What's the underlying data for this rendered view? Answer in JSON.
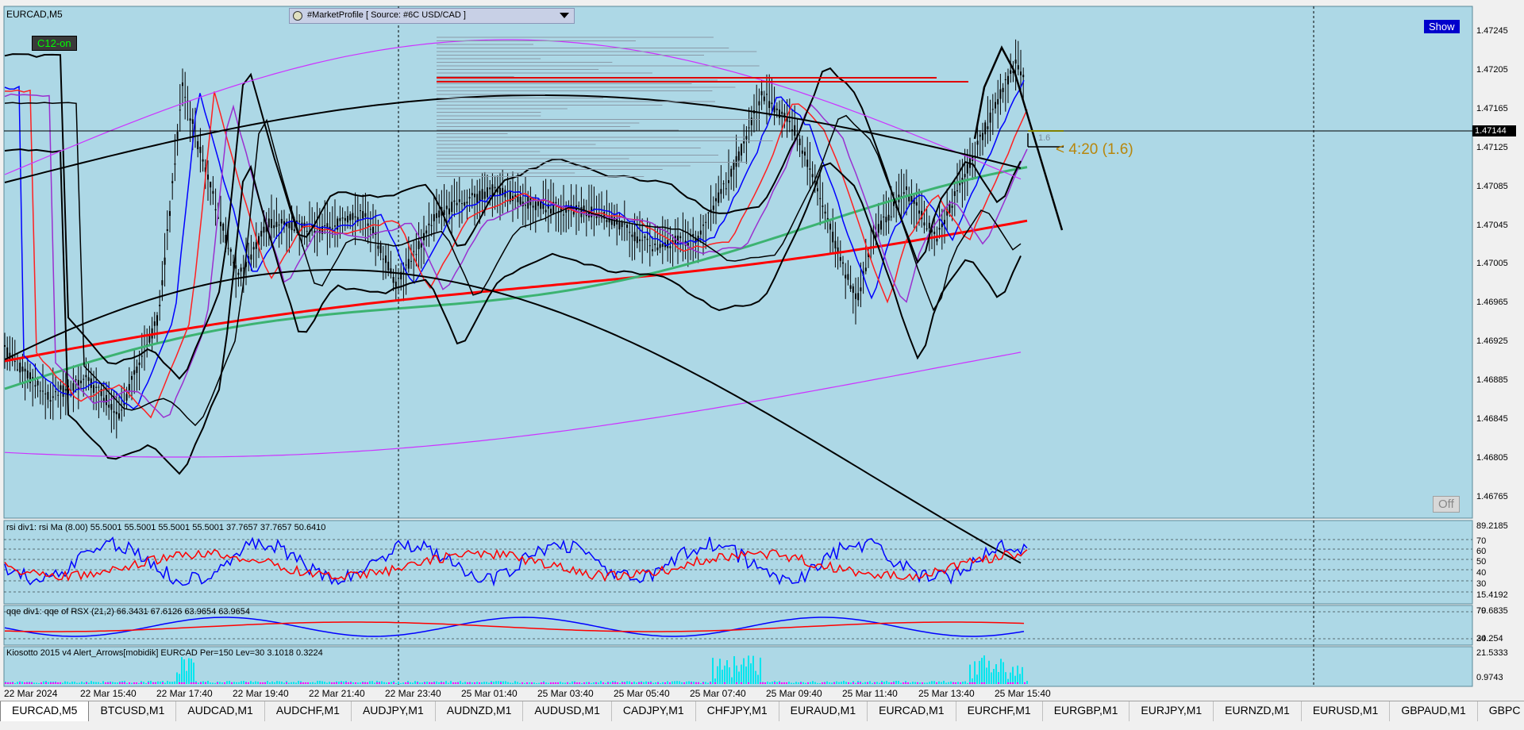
{
  "window": {
    "symbol_title": "EURCAD,M5",
    "market_profile_label": "#MarketProfile [ Source: #6C USD/CAD ]",
    "c12_label": "C12-on",
    "show_label": "Show",
    "off_label": "Off",
    "current_price": "1.47144",
    "countdown_label": "< 4:20 (1.6)",
    "spread_label": "1.6"
  },
  "price_axis": {
    "ticks": [
      "1.47245",
      "1.47205",
      "1.47165",
      "1.47125",
      "1.47085",
      "1.47045",
      "1.47005",
      "1.46965",
      "1.46925",
      "1.46885",
      "1.46845",
      "1.46805",
      "1.46765"
    ]
  },
  "time_axis": {
    "ticks": [
      "22 Mar 2024",
      "22 Mar 15:40",
      "22 Mar 17:40",
      "22 Mar 19:40",
      "22 Mar 21:40",
      "22 Mar 23:40",
      "25 Mar 01:40",
      "25 Mar 03:40",
      "25 Mar 05:40",
      "25 Mar 07:40",
      "25 Mar 09:40",
      "25 Mar 11:40",
      "25 Mar 13:40",
      "25 Mar 15:40"
    ]
  },
  "rsi_panel": {
    "title": "rsi div1: rsi Ma (8.00) 55.5001 55.5001 55.5001 55.5001 37.7657 37.7657 50.6410",
    "levels": [
      "89.2185",
      "70",
      "60",
      "50",
      "40",
      "30",
      "15.4192"
    ]
  },
  "rsx_panel": {
    "title": "qqe div1: qqe of RSX (21,2) 66.3431 67.6126 63.9654 63.9654",
    "levels": [
      "79.6835",
      "70",
      "24.254",
      "30"
    ]
  },
  "kiosotto_panel": {
    "title": "Kiosotto 2015 v4 Alert_Arrows[mobidik] EURCAD Per=150 Lev=30 3.1018 0.3224",
    "levels": [
      "21.5333",
      "0.9743"
    ]
  },
  "tabs": [
    "EURCAD,M5",
    "BTCUSD,M1",
    "AUDCAD,M1",
    "AUDCHF,M1",
    "AUDJPY,M1",
    "AUDNZD,M1",
    "AUDUSD,M1",
    "CADJPY,M1",
    "CHFJPY,M1",
    "EURAUD,M1",
    "EURCAD,M1",
    "EURCHF,M1",
    "EURGBP,M1",
    "EURJPY,M1",
    "EURNZD,M1",
    "EURUSD,M1",
    "GBPAUD,M1",
    "GBPC"
  ],
  "colors": {
    "chart_bg": "#add8e6",
    "up_candle": "#000000",
    "ma_red": "#ff0000",
    "ma_green": "#3cb371",
    "ma_blue": "#0000ff",
    "band_violet": "#cc33ff",
    "rsi_blue": "#0000ff",
    "rsi_red": "#ff0000",
    "kiosotto_cyan": "#00e5ee",
    "kiosotto_magenta": "#ff00ff",
    "countdown_color": "#b8860b"
  }
}
